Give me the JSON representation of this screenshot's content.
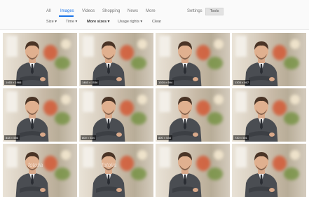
{
  "tabs": [
    {
      "label": "All",
      "active": false
    },
    {
      "label": "Images",
      "active": true
    },
    {
      "label": "Videos",
      "active": false
    },
    {
      "label": "Shopping",
      "active": false
    },
    {
      "label": "News",
      "active": false
    },
    {
      "label": "More",
      "active": false
    }
  ],
  "settings_label": "Settings",
  "tools_label": "Tools",
  "filters": [
    "Size ▾",
    "Time ▾",
    "More sizes ▾",
    "Usage rights ▾",
    "Clear"
  ],
  "thumbnails": [
    {
      "size": "1463 × 1966"
    },
    {
      "size": "1463 × 1536"
    },
    {
      "size": "1024 × 694"
    },
    {
      "size": "1303 × 667"
    },
    {
      "size": "848 × 556"
    },
    {
      "size": "800 × 534"
    },
    {
      "size": "800 × 533"
    },
    {
      "size": "730 × 501"
    },
    {
      "size": ""
    },
    {
      "size": ""
    },
    {
      "size": ""
    },
    {
      "size": ""
    }
  ],
  "watermarks": [
    "fotolia",
    "fotolia"
  ],
  "colors": {
    "accent": "#1a73e8",
    "topbar_bg": "#fafafa"
  }
}
